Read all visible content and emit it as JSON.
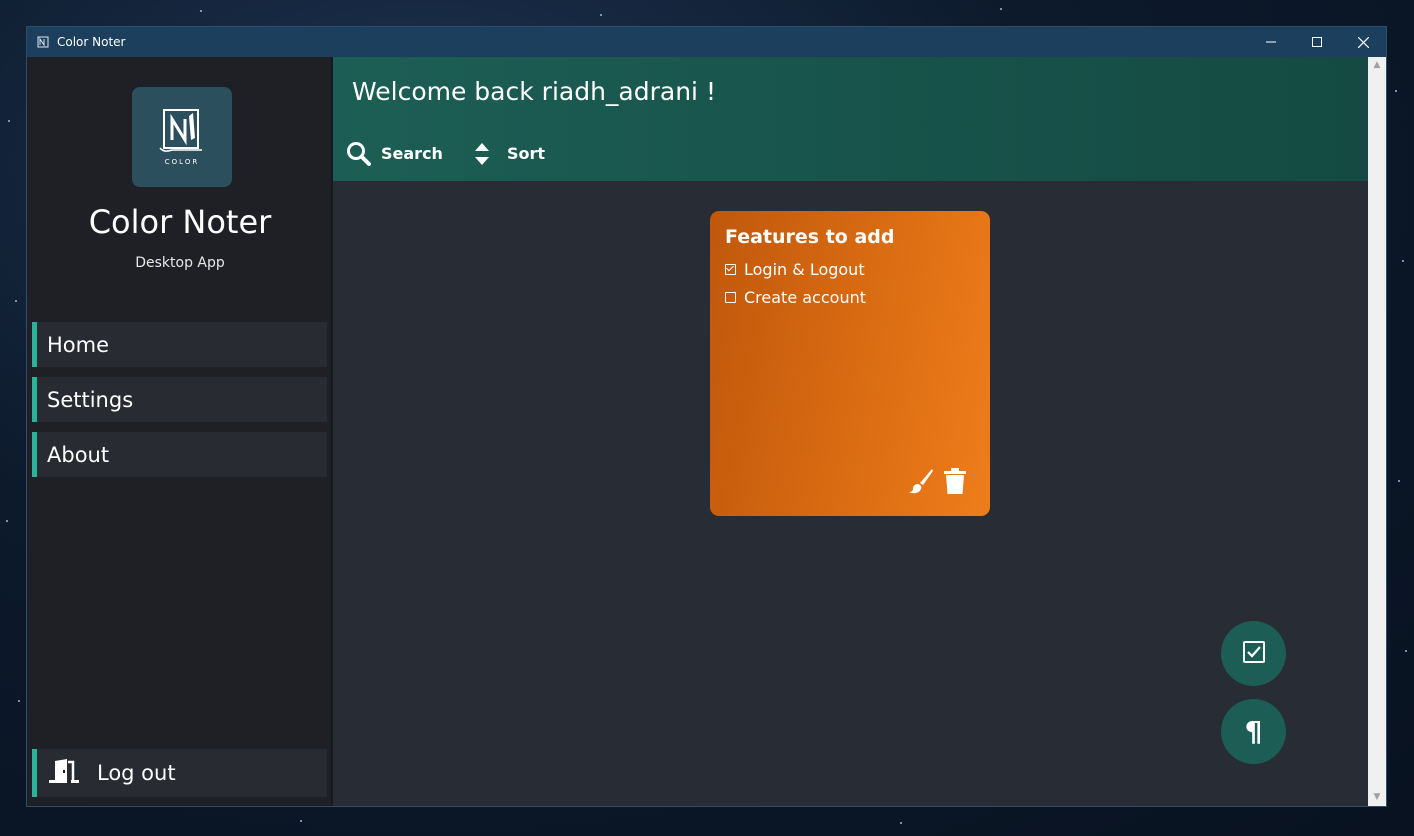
{
  "window": {
    "title": "Color Noter",
    "controls": {
      "minimize": "─",
      "maximize": "☐",
      "close": "✕"
    }
  },
  "sidebar": {
    "logo_text": "COLOR",
    "app_name": "Color Noter",
    "app_subtitle": "Desktop App",
    "nav": [
      {
        "label": "Home"
      },
      {
        "label": "Settings"
      },
      {
        "label": "About"
      }
    ],
    "logout_label": "Log out"
  },
  "header": {
    "welcome": "Welcome back riadh_adrani !",
    "search_label": "Search",
    "sort_label": "Sort"
  },
  "notes": [
    {
      "title": "Features to add",
      "color": "#e0701a",
      "items": [
        {
          "text": "Login & Logout",
          "checked": true
        },
        {
          "text": "Create account",
          "checked": false
        }
      ]
    }
  ],
  "fabs": {
    "checklist_icon": "checkbox-icon",
    "paragraph_icon": "¶"
  },
  "colors": {
    "accent": "#2bb39a",
    "header": "#1c5e55",
    "sidebar": "#1e2026",
    "main_bg": "#282c34",
    "titlebar": "#1c3f5d"
  }
}
